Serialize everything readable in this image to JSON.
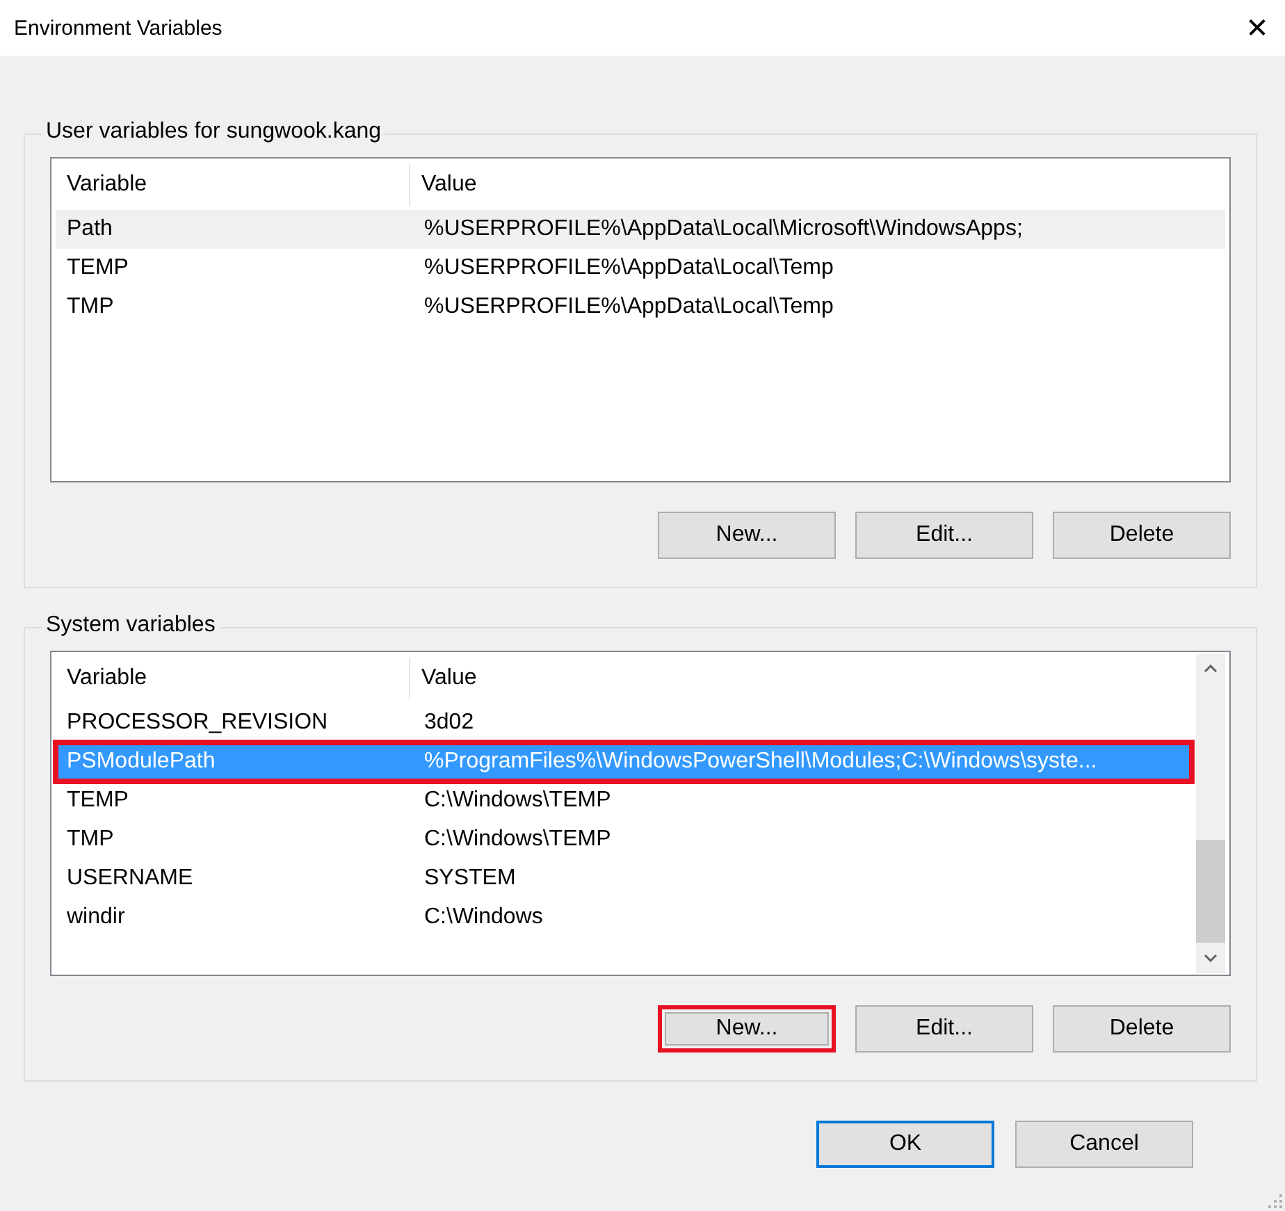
{
  "window": {
    "title": "Environment Variables",
    "close": "✕"
  },
  "groups": [
    {
      "label": "User variables for sungwook.kang",
      "focused": false,
      "scrollbar": false,
      "columns": [
        "Variable",
        "Value"
      ],
      "rows": [
        {
          "variable": "Path",
          "value": "%USERPROFILE%\\AppData\\Local\\Microsoft\\WindowsApps;",
          "selected": true,
          "highlighted": false
        },
        {
          "variable": "TEMP",
          "value": "%USERPROFILE%\\AppData\\Local\\Temp",
          "selected": false,
          "highlighted": false
        },
        {
          "variable": "TMP",
          "value": "%USERPROFILE%\\AppData\\Local\\Temp",
          "selected": false,
          "highlighted": false
        }
      ],
      "buttons": [
        {
          "label": "New...",
          "highlighted": false
        },
        {
          "label": "Edit...",
          "highlighted": false
        },
        {
          "label": "Delete",
          "highlighted": false
        }
      ]
    },
    {
      "label": "System variables",
      "focused": true,
      "scrollbar": true,
      "columns": [
        "Variable",
        "Value"
      ],
      "rows": [
        {
          "variable": "PROCESSOR_REVISION",
          "value": "3d02",
          "selected": false,
          "highlighted": false
        },
        {
          "variable": "PSModulePath",
          "value": "%ProgramFiles%\\WindowsPowerShell\\Modules;C:\\Windows\\syste...",
          "selected": true,
          "highlighted": true
        },
        {
          "variable": "TEMP",
          "value": "C:\\Windows\\TEMP",
          "selected": false,
          "highlighted": false
        },
        {
          "variable": "TMP",
          "value": "C:\\Windows\\TEMP",
          "selected": false,
          "highlighted": false
        },
        {
          "variable": "USERNAME",
          "value": "SYSTEM",
          "selected": false,
          "highlighted": false
        },
        {
          "variable": "windir",
          "value": "C:\\Windows",
          "selected": false,
          "highlighted": false
        }
      ],
      "buttons": [
        {
          "label": "New...",
          "highlighted": true
        },
        {
          "label": "Edit...",
          "highlighted": false
        },
        {
          "label": "Delete",
          "highlighted": false
        }
      ]
    }
  ],
  "footer_buttons": [
    {
      "label": "OK",
      "default": true
    },
    {
      "label": "Cancel",
      "default": false
    }
  ]
}
